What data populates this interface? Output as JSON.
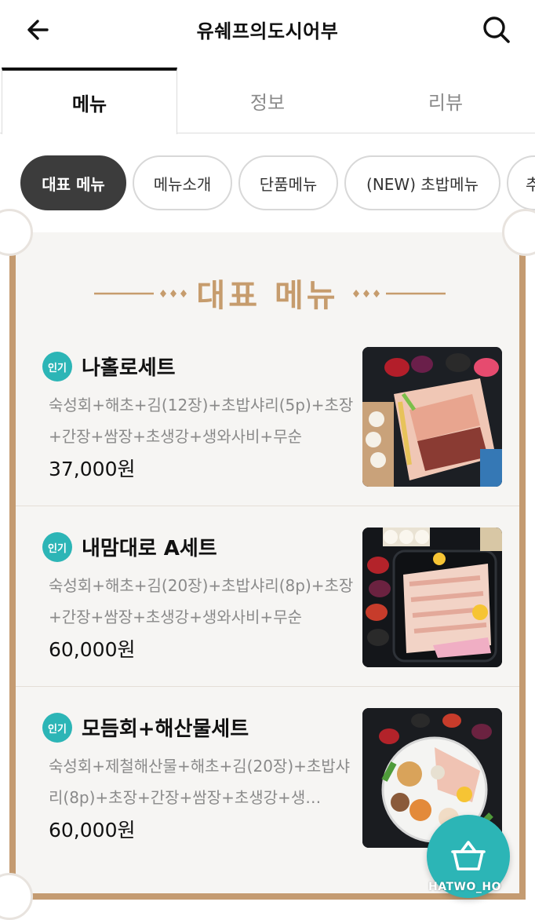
{
  "header": {
    "title": "유쉐프의도시어부"
  },
  "tabs": [
    {
      "label": "메뉴",
      "active": true
    },
    {
      "label": "정보",
      "active": false
    },
    {
      "label": "리뷰",
      "active": false
    }
  ],
  "chips": [
    {
      "label": "대표 메뉴",
      "active": true
    },
    {
      "label": "메뉴소개",
      "active": false
    },
    {
      "label": "단품메뉴",
      "active": false
    },
    {
      "label": "(NEW) 초밥메뉴",
      "active": false
    },
    {
      "label": "추",
      "active": false
    }
  ],
  "section": {
    "title": "대표 메뉴"
  },
  "items": [
    {
      "badge": "인기",
      "name": "나홀로세트",
      "description": "숙성회+해초+김(12장)+초밥샤리(5p)+초장+간장+쌈장+초생강+생와사비+무순",
      "price": "37,000원"
    },
    {
      "badge": "인기",
      "name": "내맘대로 A세트",
      "description": "숙성회+해초+김(20장)+초밥샤리(8p)+초장+간장+쌈장+초생강+생와사비+무순",
      "price": "60,000원"
    },
    {
      "badge": "인기",
      "name": "모듬회+해산물세트",
      "description": "숙성회+제철해산물+해초+김(20장)+초밥샤리(8p)+초장+간장+쌈장+초생강+생…",
      "price": "60,000원"
    }
  ],
  "watermark": "HATWO_HO",
  "colors": {
    "accent": "#2cb5b6",
    "gold": "#c69c6d",
    "frame": "#c49b71"
  },
  "icons": {
    "back": "arrow-left-icon",
    "search": "search-icon",
    "cart": "shopping-basket-icon"
  }
}
